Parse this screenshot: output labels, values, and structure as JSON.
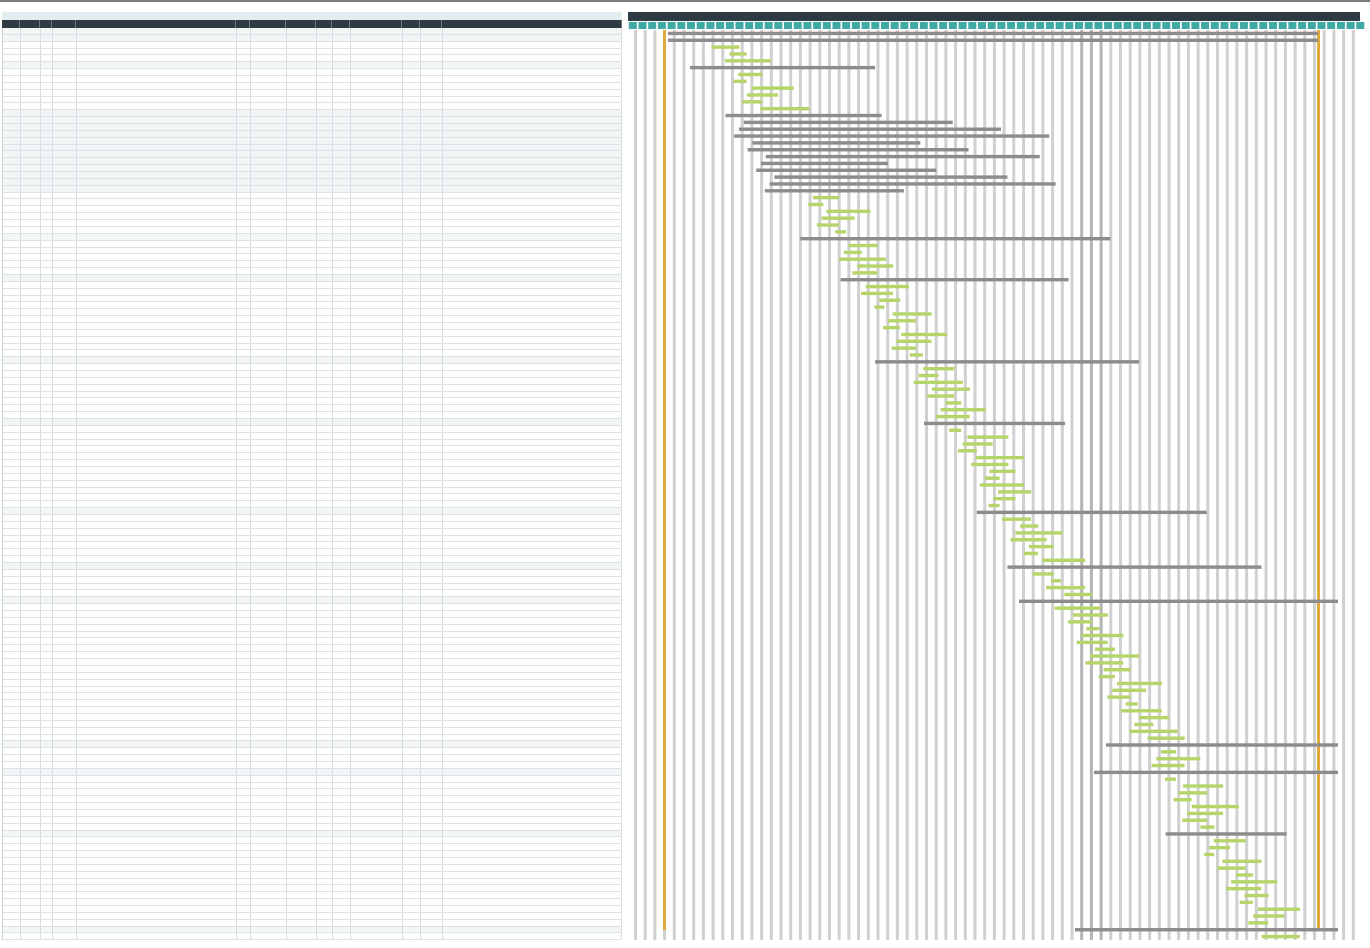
{
  "table": {
    "rows": [
      {
        "kind": "summary"
      },
      {
        "kind": "summary"
      },
      {
        "kind": "task"
      },
      {
        "kind": "task"
      },
      {
        "kind": "task"
      },
      {
        "kind": "summary"
      },
      {
        "kind": "task"
      },
      {
        "kind": "task"
      },
      {
        "kind": "task"
      },
      {
        "kind": "task"
      },
      {
        "kind": "task"
      },
      {
        "kind": "task"
      },
      {
        "kind": "summary"
      },
      {
        "kind": "summary"
      },
      {
        "kind": "summary"
      },
      {
        "kind": "summary"
      },
      {
        "kind": "summary"
      },
      {
        "kind": "summary"
      },
      {
        "kind": "summary"
      },
      {
        "kind": "summary"
      },
      {
        "kind": "summary"
      },
      {
        "kind": "summary"
      },
      {
        "kind": "summary"
      },
      {
        "kind": "summary"
      },
      {
        "kind": "task"
      },
      {
        "kind": "task"
      },
      {
        "kind": "task"
      },
      {
        "kind": "task"
      },
      {
        "kind": "task"
      },
      {
        "kind": "task"
      },
      {
        "kind": "summary"
      },
      {
        "kind": "task"
      },
      {
        "kind": "task"
      },
      {
        "kind": "task"
      },
      {
        "kind": "task"
      },
      {
        "kind": "task"
      },
      {
        "kind": "summary"
      },
      {
        "kind": "task"
      },
      {
        "kind": "task"
      },
      {
        "kind": "task"
      },
      {
        "kind": "task"
      },
      {
        "kind": "task"
      },
      {
        "kind": "task"
      },
      {
        "kind": "task"
      },
      {
        "kind": "task"
      },
      {
        "kind": "task"
      },
      {
        "kind": "task"
      },
      {
        "kind": "task"
      },
      {
        "kind": "summary"
      },
      {
        "kind": "task"
      },
      {
        "kind": "task"
      },
      {
        "kind": "task"
      },
      {
        "kind": "task"
      },
      {
        "kind": "task"
      },
      {
        "kind": "task"
      },
      {
        "kind": "task"
      },
      {
        "kind": "task"
      },
      {
        "kind": "summary"
      },
      {
        "kind": "task"
      },
      {
        "kind": "task"
      },
      {
        "kind": "task"
      },
      {
        "kind": "task"
      },
      {
        "kind": "task"
      },
      {
        "kind": "task"
      },
      {
        "kind": "task"
      },
      {
        "kind": "task"
      },
      {
        "kind": "task"
      },
      {
        "kind": "task"
      },
      {
        "kind": "task"
      },
      {
        "kind": "task"
      },
      {
        "kind": "summary"
      },
      {
        "kind": "task"
      },
      {
        "kind": "task"
      },
      {
        "kind": "task"
      },
      {
        "kind": "task"
      },
      {
        "kind": "task"
      },
      {
        "kind": "task"
      },
      {
        "kind": "task"
      },
      {
        "kind": "summary"
      },
      {
        "kind": "task"
      },
      {
        "kind": "task"
      },
      {
        "kind": "task"
      },
      {
        "kind": "task"
      },
      {
        "kind": "summary"
      },
      {
        "kind": "task"
      },
      {
        "kind": "task"
      },
      {
        "kind": "task"
      },
      {
        "kind": "task"
      },
      {
        "kind": "task"
      },
      {
        "kind": "task"
      },
      {
        "kind": "task"
      },
      {
        "kind": "task"
      },
      {
        "kind": "task"
      },
      {
        "kind": "task"
      },
      {
        "kind": "task"
      },
      {
        "kind": "task"
      },
      {
        "kind": "task"
      },
      {
        "kind": "task"
      },
      {
        "kind": "task"
      },
      {
        "kind": "task"
      },
      {
        "kind": "task"
      },
      {
        "kind": "task"
      },
      {
        "kind": "task"
      },
      {
        "kind": "task"
      },
      {
        "kind": "summary"
      },
      {
        "kind": "task"
      },
      {
        "kind": "task"
      },
      {
        "kind": "task"
      },
      {
        "kind": "summary"
      },
      {
        "kind": "task"
      },
      {
        "kind": "task"
      },
      {
        "kind": "task"
      },
      {
        "kind": "task"
      },
      {
        "kind": "task"
      },
      {
        "kind": "task"
      },
      {
        "kind": "task"
      },
      {
        "kind": "task"
      },
      {
        "kind": "summary"
      },
      {
        "kind": "task"
      },
      {
        "kind": "task"
      },
      {
        "kind": "task"
      },
      {
        "kind": "task"
      },
      {
        "kind": "task"
      },
      {
        "kind": "task"
      },
      {
        "kind": "task"
      },
      {
        "kind": "task"
      },
      {
        "kind": "task"
      },
      {
        "kind": "task"
      },
      {
        "kind": "task"
      },
      {
        "kind": "task"
      },
      {
        "kind": "task"
      },
      {
        "kind": "summary"
      },
      {
        "kind": "task"
      }
    ]
  }
}
